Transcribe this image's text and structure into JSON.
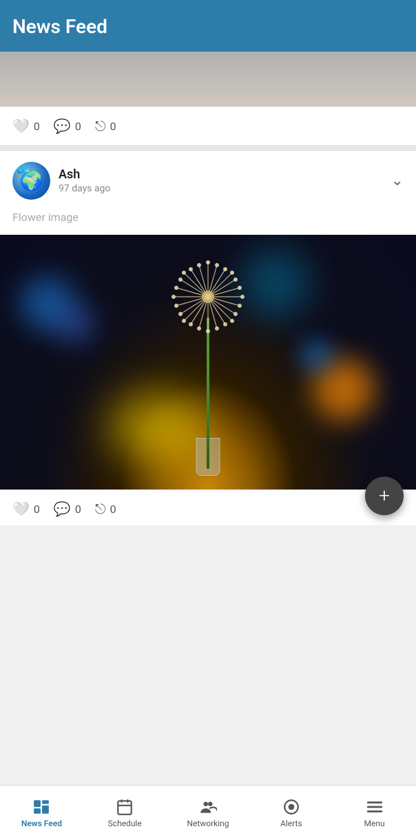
{
  "header": {
    "title": "News Feed"
  },
  "first_post": {
    "like_count": "0",
    "comment_count": "0",
    "share_count": "0"
  },
  "second_post": {
    "author": "Ash",
    "time_ago": "97 days ago",
    "caption": "Flower image",
    "like_count": "0",
    "comment_count": "0",
    "share_count": "0",
    "chevron_symbol": "❯"
  },
  "fab": {
    "label": "+"
  },
  "bottom_nav": {
    "items": [
      {
        "id": "news-feed",
        "label": "News Feed",
        "active": true
      },
      {
        "id": "schedule",
        "label": "Schedule",
        "active": false
      },
      {
        "id": "networking",
        "label": "Networking",
        "active": false
      },
      {
        "id": "alerts",
        "label": "Alerts",
        "active": false
      },
      {
        "id": "menu",
        "label": "Menu",
        "active": false
      }
    ]
  }
}
